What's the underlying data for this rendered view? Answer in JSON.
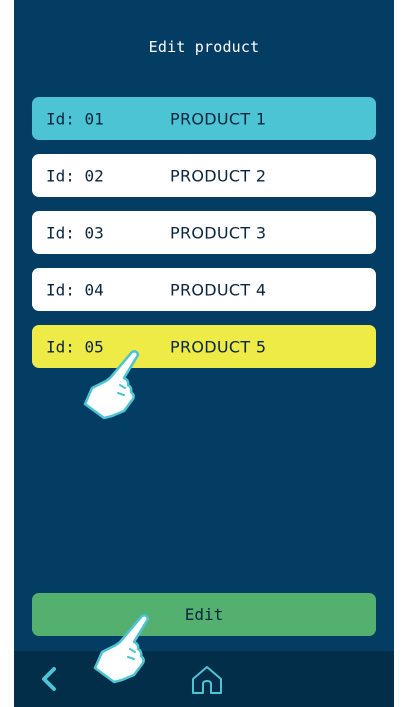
{
  "header": {
    "title": "Edit product"
  },
  "products": [
    {
      "id_label": "Id: 01",
      "name": "PRODUCT 1",
      "state": "active"
    },
    {
      "id_label": "Id: 02",
      "name": "PRODUCT 2",
      "state": "normal"
    },
    {
      "id_label": "Id: 03",
      "name": "PRODUCT 3",
      "state": "normal"
    },
    {
      "id_label": "Id: 04",
      "name": "PRODUCT 4",
      "state": "normal"
    },
    {
      "id_label": "Id: 05",
      "name": "PRODUCT 5",
      "state": "selected"
    }
  ],
  "actions": {
    "edit_label": "Edit"
  },
  "nav": {
    "back_icon": "chevron-left-icon",
    "home_icon": "home-icon"
  },
  "colors": {
    "background": "#033d63",
    "bottom_bar": "#022e4a",
    "active_row": "#4cc4d3",
    "selected_row": "#eeea46",
    "row": "#ffffff",
    "edit_button": "#54b06f",
    "nav_icon": "#4cc4d3"
  }
}
